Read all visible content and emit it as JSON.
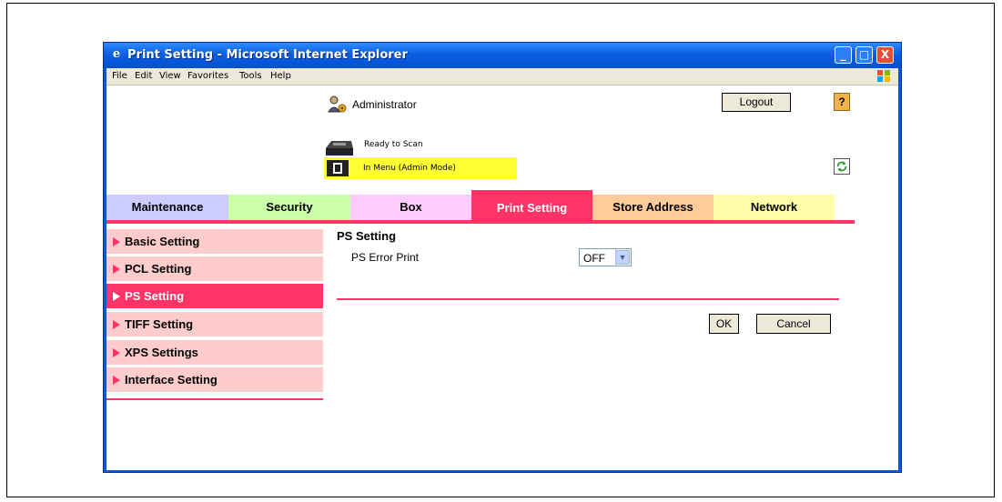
{
  "window": {
    "title": "Print Setting - Microsoft Internet Explorer",
    "controls": {
      "minimize": "_",
      "maximize": "□",
      "close": "X"
    }
  },
  "menubar": [
    "File",
    "Edit",
    "View",
    "Favorites",
    "Tools",
    "Help"
  ],
  "header": {
    "user": "Administrator",
    "logout_label": "Logout",
    "help_label": "?",
    "status_scan": "Ready to Scan",
    "status_menu": "In Menu (Admin Mode)",
    "status_menu_color": "#ffff33"
  },
  "tabs": [
    {
      "label": "Maintenance",
      "color": "#ccccff",
      "active": false
    },
    {
      "label": "Security",
      "color": "#ccffaa",
      "active": false
    },
    {
      "label": "Box",
      "color": "#ffccff",
      "active": false
    },
    {
      "label": "Print Setting",
      "color": "#ff3366",
      "active": true
    },
    {
      "label": "Store Address",
      "color": "#ffcc99",
      "active": false
    },
    {
      "label": "Network",
      "color": "#ffffaa",
      "active": false
    }
  ],
  "sidebar": [
    {
      "label": "Basic Setting",
      "active": false
    },
    {
      "label": "PCL Setting",
      "active": false
    },
    {
      "label": "PS Setting",
      "active": true
    },
    {
      "label": "TIFF Setting",
      "active": false
    },
    {
      "label": "XPS Settings",
      "active": false
    },
    {
      "label": "Interface Setting",
      "active": false
    }
  ],
  "content": {
    "title": "PS Setting",
    "field_label": "PS Error Print",
    "field_value": "OFF",
    "ok_label": "OK",
    "cancel_label": "Cancel"
  },
  "colors": {
    "accent": "#ff3366",
    "sidebar_bg": "#ffcccc",
    "titlebar": "#0a5fe0"
  }
}
